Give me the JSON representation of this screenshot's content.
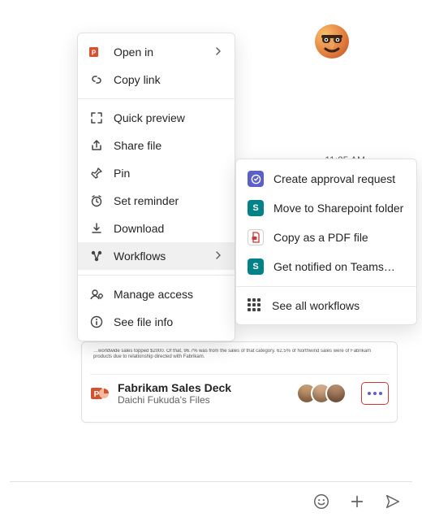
{
  "timestamp": "11:25 AM",
  "file": {
    "title": "Fabrikam Sales Deck",
    "subtitle": "Daichi Fukuda's Files",
    "thumb_text": "…worldwide sales topped $2000. Of that, 96.7% was from the sales of that category. 62.5% of Northwind sales were of Fabrikam products due to relationship directed with Fabrikam."
  },
  "menu": {
    "open_in": "Open in",
    "copy_link": "Copy link",
    "quick_preview": "Quick preview",
    "share_file": "Share file",
    "pin": "Pin",
    "set_reminder": "Set reminder",
    "download": "Download",
    "workflows": "Workflows",
    "manage_access": "Manage access",
    "see_file_info": "See file info"
  },
  "submenu": {
    "approval": "Create approval request",
    "move_sp": "Move to Sharepoint folder",
    "copy_pdf": "Copy as a PDF file",
    "notify": "Get notified on Teams…",
    "see_all": "See all workflows"
  }
}
